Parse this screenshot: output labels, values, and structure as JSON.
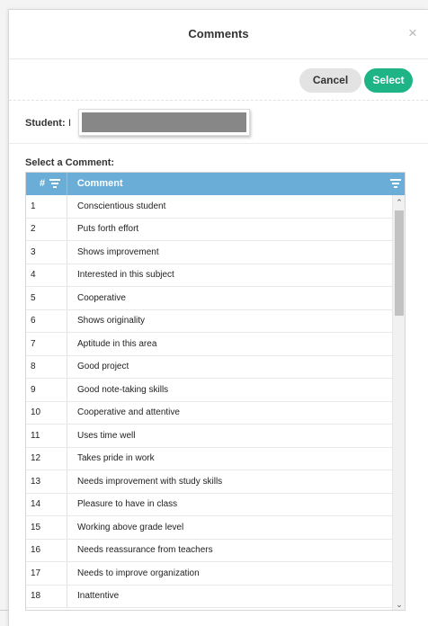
{
  "dialog": {
    "title": "Comments",
    "close_glyph": "×"
  },
  "toolbar": {
    "cancel_label": "Cancel",
    "select_label": "Select"
  },
  "student": {
    "label": "Student:",
    "name_partial": "I"
  },
  "comment_picker": {
    "label": "Select a Comment:",
    "columns": [
      "#",
      "Comment"
    ],
    "rows": [
      {
        "num": "1",
        "comment": "Conscientious student"
      },
      {
        "num": "2",
        "comment": "Puts forth effort"
      },
      {
        "num": "3",
        "comment": "Shows improvement"
      },
      {
        "num": "4",
        "comment": "Interested in this subject"
      },
      {
        "num": "5",
        "comment": "Cooperative"
      },
      {
        "num": "6",
        "comment": "Shows originality"
      },
      {
        "num": "7",
        "comment": "Aptitude in this area"
      },
      {
        "num": "8",
        "comment": "Good project"
      },
      {
        "num": "9",
        "comment": "Good note-taking skills"
      },
      {
        "num": "10",
        "comment": "Cooperative and attentive"
      },
      {
        "num": "11",
        "comment": "Uses time well"
      },
      {
        "num": "12",
        "comment": "Takes pride in work"
      },
      {
        "num": "13",
        "comment": "Needs improvement with study skills"
      },
      {
        "num": "14",
        "comment": "Pleasure to have in class"
      },
      {
        "num": "15",
        "comment": "Working above grade level"
      },
      {
        "num": "16",
        "comment": "Needs reassurance from teachers"
      },
      {
        "num": "17",
        "comment": "Needs to improve organization"
      },
      {
        "num": "18",
        "comment": "Inattentive"
      }
    ]
  },
  "icons": {
    "column_filter": "filter-icon",
    "scroll_up": "chevron-up-icon",
    "scroll_down": "chevron-down-icon"
  },
  "colors": {
    "header_blue": "#6aaed8",
    "select_green": "#1fb486",
    "cancel_gray": "#e3e3e3"
  }
}
